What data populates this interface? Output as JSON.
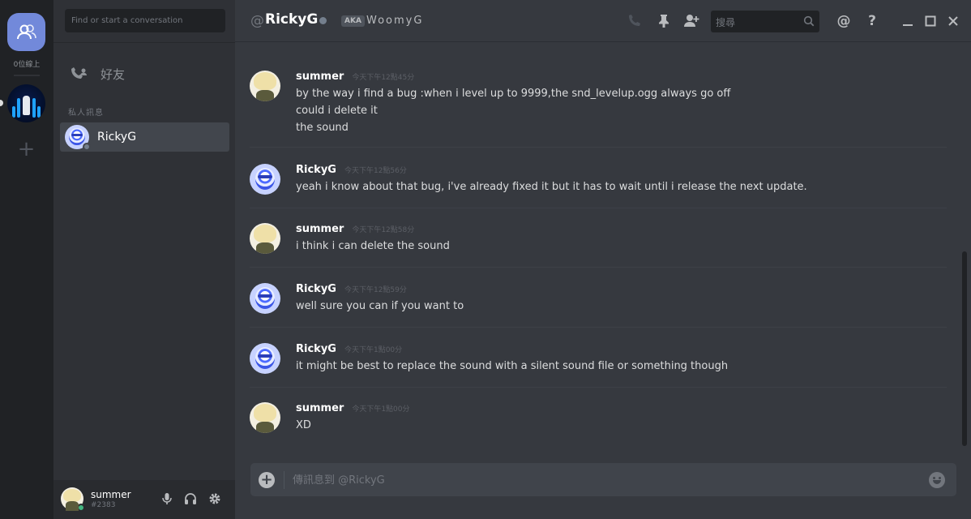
{
  "rail": {
    "online_label": "0位線上",
    "home_icon": "friends-icon",
    "add_server_label": "+"
  },
  "sidebar": {
    "search_placeholder": "Find or start a conversation",
    "friends_label": "好友",
    "dm_header": "私人訊息",
    "dms": [
      {
        "name": "RickyG",
        "status_color": "#747f8d"
      }
    ]
  },
  "user_panel": {
    "username": "summer",
    "tag": "#2383",
    "status_color": "#43b581"
  },
  "header": {
    "at_symbol": "@",
    "recipient": "RickyG",
    "aka_badge": "AKA",
    "nickname": "WoomyG",
    "search_placeholder": "搜尋"
  },
  "messages": [
    {
      "author": "summer",
      "avatar": "summer",
      "timestamp": "今天下午12點45分",
      "lines": [
        "by the way i find a bug :when i level up to 9999,the snd_levelup.ogg always go off",
        "could i delete it",
        "the sound"
      ]
    },
    {
      "author": "RickyG",
      "avatar": "ricky",
      "timestamp": "今天下午12點56分",
      "lines": [
        "yeah i know about that bug, i've already fixed it but it has to wait until i release the next update."
      ]
    },
    {
      "author": "summer",
      "avatar": "summer",
      "timestamp": "今天下午12點58分",
      "lines": [
        "i think i can delete the sound"
      ]
    },
    {
      "author": "RickyG",
      "avatar": "ricky",
      "timestamp": "今天下午12點59分",
      "lines": [
        "well sure you can if you want to"
      ]
    },
    {
      "author": "RickyG",
      "avatar": "ricky",
      "timestamp": "今天下午1點00分",
      "lines": [
        "it might be best to replace the sound with a silent sound file or something though"
      ]
    },
    {
      "author": "summer",
      "avatar": "summer",
      "timestamp": "今天下午1點00分",
      "lines": [
        "XD"
      ]
    }
  ],
  "composer": {
    "placeholder": "傳訊息到 @RickyG"
  },
  "colors": {
    "accent": "#7289da",
    "background": "#36393f",
    "sidebar": "#2f3136",
    "rail": "#202225"
  }
}
